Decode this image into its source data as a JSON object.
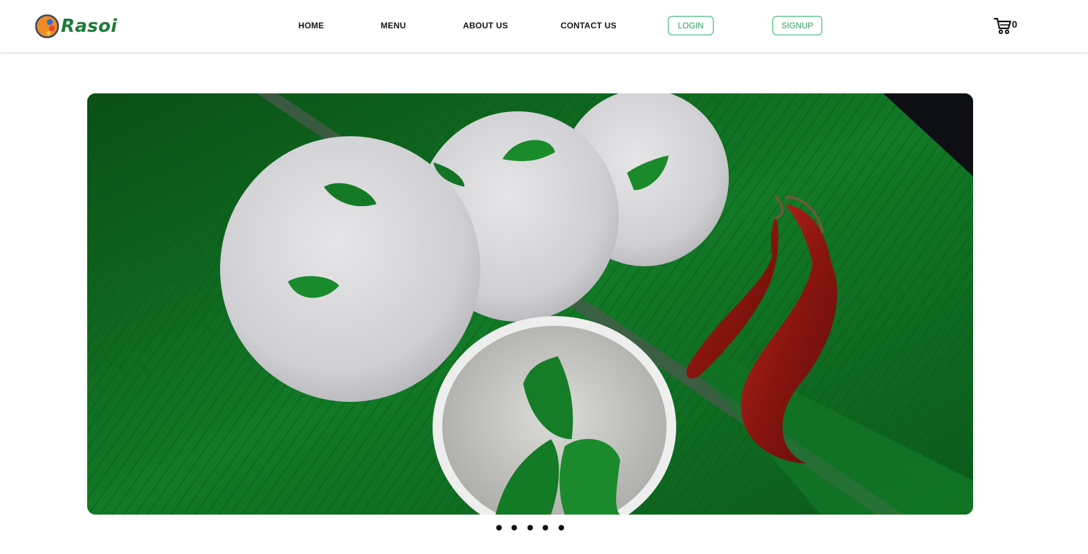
{
  "brand": {
    "name": "Rasoi",
    "logo_colors": [
      "#f08a24",
      "#2d6bd6",
      "#e04a2a"
    ]
  },
  "nav": {
    "home": "HOME",
    "menu": "MENU",
    "about": "ABOUT US",
    "contact": "CONTACT US",
    "login": "LOGIN",
    "signup": "SIGNUP"
  },
  "cart": {
    "icon": "cart-icon",
    "count": "0"
  },
  "hero": {
    "image": "idli-with-coconut-chutney-and-red-chillies-on-banana-leaf"
  },
  "carousel": {
    "slides": 5,
    "active": 1
  },
  "colors": {
    "accent": "#2db36a",
    "brand_green": "#1f7a3a",
    "leaf_green": "#0c5e1c"
  }
}
